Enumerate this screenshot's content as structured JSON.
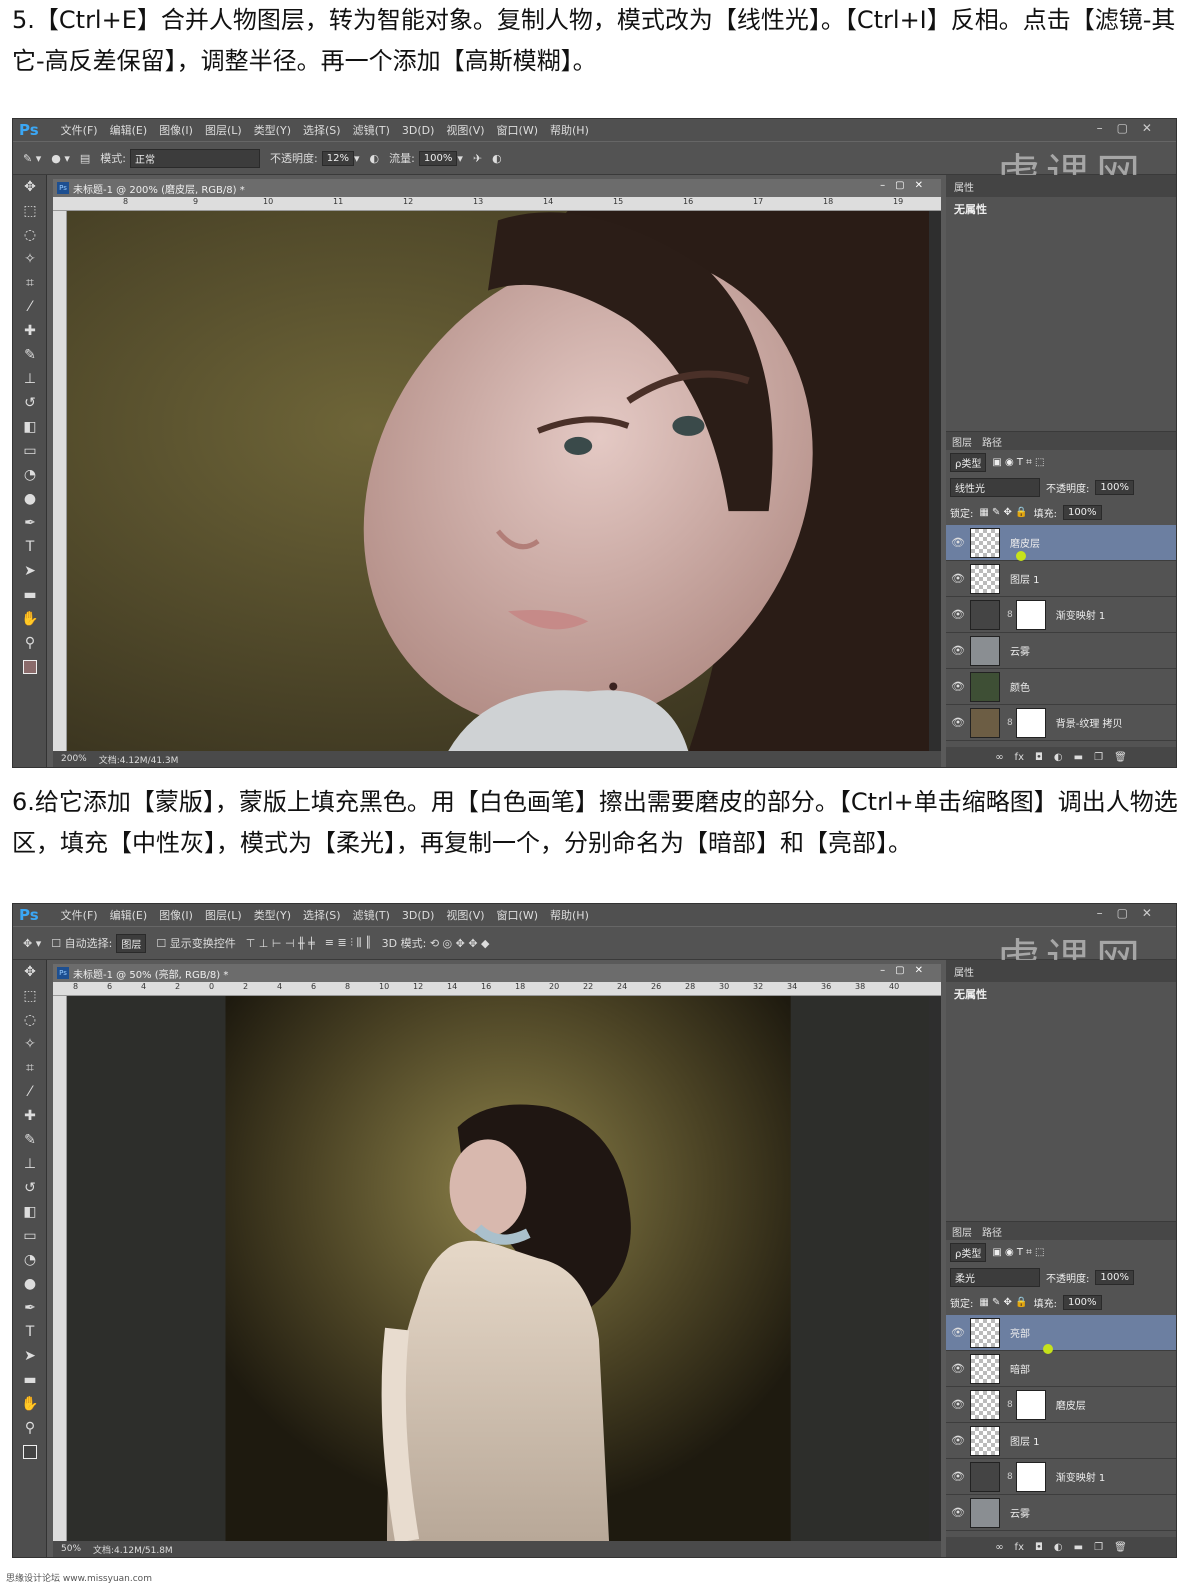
{
  "step5": {
    "text": "5.【Ctrl+E】合并人物图层，转为智能对象。复制人物，模式改为【线性光】。【Ctrl+I】反相。点击【滤镜-其它-高反差保留】，调整半径。再一个添加【高斯模糊】。"
  },
  "step6": {
    "text": "6.给它添加【蒙版】，蒙版上填充黑色。用【白色画笔】擦出需要磨皮的部分。【Ctrl+单击缩略图】调出人物选区，填充【中性灰】，模式为【柔光】，再复制一个，分别命名为【暗部】和【亮部】。"
  },
  "menu": [
    "文件(F)",
    "编辑(E)",
    "图像(I)",
    "图层(L)",
    "类型(Y)",
    "选择(S)",
    "滤镜(T)",
    "3D(D)",
    "视图(V)",
    "窗口(W)",
    "帮助(H)"
  ],
  "app_logo": "Ps",
  "watermark": "虎课网",
  "shot1": {
    "options": {
      "mode_label": "模式:",
      "mode_value": "正常",
      "opacity_label": "不透明度:",
      "opacity_value": "12%",
      "flow_label": "流量:",
      "flow_value": "100%"
    },
    "doc_title": "未标题-1 @ 200% (磨皮层, RGB/8) *",
    "ruler": [
      "8",
      "9",
      "10",
      "11",
      "12",
      "13",
      "14",
      "15",
      "16",
      "17",
      "18",
      "19"
    ],
    "zoom": "200%",
    "doc_size": "文档:4.12M/41.3M",
    "props_title": "属性",
    "props_sub": "无属性",
    "layers_tabs": [
      "图层",
      "路径"
    ],
    "filter_kind": "ρ类型",
    "blend_mode": "线性光",
    "opacity_label": "不透明度:",
    "opacity": "100%",
    "lock_label": "锁定:",
    "fill_label": "填充:",
    "fill": "100%",
    "layers": [
      {
        "name": "磨皮层",
        "selected": true,
        "mask": false,
        "thumb": "figure"
      },
      {
        "name": "图层 1",
        "selected": false,
        "mask": false,
        "thumb": "figure"
      },
      {
        "name": "渐变映射 1",
        "selected": false,
        "mask": true,
        "thumb": "adjust"
      },
      {
        "name": "云雾",
        "selected": false,
        "mask": false,
        "thumb": "cloud"
      },
      {
        "name": "颜色",
        "selected": false,
        "mask": false,
        "thumb": "green"
      },
      {
        "name": "背景-纹理 拷贝",
        "selected": false,
        "mask": true,
        "thumb": "texture"
      }
    ]
  },
  "shot2": {
    "options": {
      "auto_select": "自动选择:",
      "auto_value": "图层",
      "show_transform": "显示变换控件",
      "mode3d": "3D 模式:"
    },
    "doc_title": "未标题-1 @ 50% (亮部, RGB/8) *",
    "ruler": [
      "8",
      "6",
      "4",
      "2",
      "0",
      "2",
      "4",
      "6",
      "8",
      "10",
      "12",
      "14",
      "16",
      "18",
      "20",
      "22",
      "24",
      "26",
      "28",
      "30",
      "32",
      "34",
      "36",
      "38",
      "40"
    ],
    "zoom": "50%",
    "doc_size": "文档:4.12M/51.8M",
    "props_title": "属性",
    "props_sub": "无属性",
    "layers_tabs": [
      "图层",
      "路径"
    ],
    "filter_kind": "ρ类型",
    "blend_mode": "柔光",
    "opacity_label": "不透明度:",
    "opacity": "100%",
    "lock_label": "锁定:",
    "fill_label": "填充:",
    "fill": "100%",
    "layers": [
      {
        "name": "亮部",
        "selected": true,
        "mask": false,
        "thumb": "figure"
      },
      {
        "name": "暗部",
        "selected": false,
        "mask": false,
        "thumb": "figure"
      },
      {
        "name": "磨皮层",
        "selected": false,
        "mask": true,
        "thumb": "figure"
      },
      {
        "name": "图层 1",
        "selected": false,
        "mask": false,
        "thumb": "figure"
      },
      {
        "name": "渐变映射 1",
        "selected": false,
        "mask": true,
        "thumb": "adjust"
      },
      {
        "name": "云雾",
        "selected": false,
        "mask": false,
        "thumb": "cloud"
      }
    ]
  },
  "credit": "思缘设计论坛 www.missyuan.com"
}
